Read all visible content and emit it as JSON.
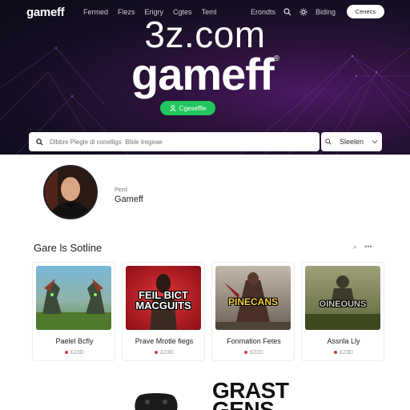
{
  "header": {
    "brand": "gameff",
    "nav": [
      "Fermed",
      "Flezs",
      "Erigry",
      "Cgtes",
      "Teml"
    ],
    "nav_right_label": "Erondts",
    "settings_label": "Biding",
    "connect_label": "Cenecs"
  },
  "hero": {
    "domain": "3z.com",
    "title": "gameff",
    "title_mark": "®",
    "cta_label": "Cgeseffle"
  },
  "search": {
    "placeholder": "Dlbbre Plegle di conelligs  Blsle Iregeae",
    "button_label": "Sleelen"
  },
  "profile": {
    "label": "Pezd",
    "name": "Gameff"
  },
  "section": {
    "title": "Gare ls Sotline",
    "actions": [
      "⌕",
      "•••"
    ]
  },
  "cards": [
    {
      "thumb_text": "",
      "title": "Paelel Bcfly",
      "meta": "£23D"
    },
    {
      "thumb_text": "FEIL BICT MACGUITS",
      "title": "Prave Mrotle fiegs",
      "meta": "£23D"
    },
    {
      "thumb_text": "PINECANS",
      "title": "Fonmation Fetes",
      "meta": "£22D"
    },
    {
      "thumb_text": "OINEOUNS",
      "title": "Assnla Lly",
      "meta": "£23D"
    }
  ],
  "bottom": {
    "logo_line1": "GRAST",
    "logo_line2": "GENS"
  },
  "colors": {
    "accent": "#22c55e",
    "hero_bg": "#160f24"
  },
  "icons": {
    "search": "search-icon",
    "settings": "gear-icon",
    "gamepad": "gamepad-icon"
  }
}
